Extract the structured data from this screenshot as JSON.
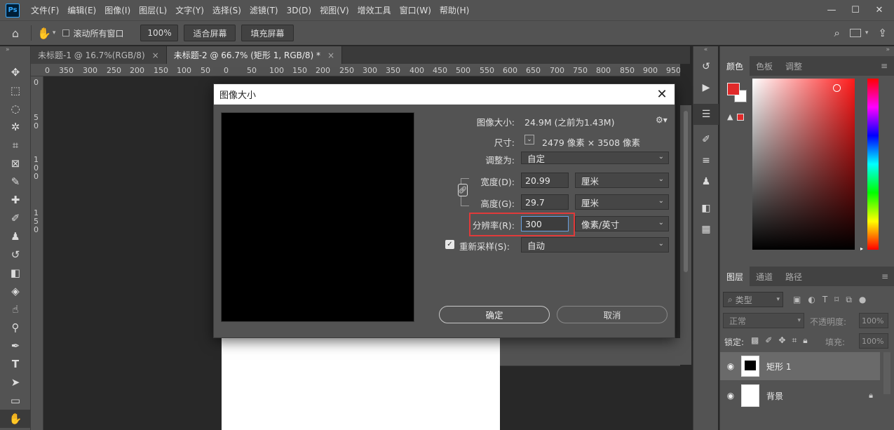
{
  "app": {
    "logo_text": "Ps"
  },
  "menu": [
    "文件(F)",
    "编辑(E)",
    "图像(I)",
    "图层(L)",
    "文字(Y)",
    "选择(S)",
    "滤镜(T)",
    "3D(D)",
    "视图(V)",
    "增效工具",
    "窗口(W)",
    "帮助(H)"
  ],
  "options": {
    "scroll_all_label": "滚动所有窗口",
    "zoom_value": "100%",
    "fit_screen": "适合屏幕",
    "fill_screen": "填充屏幕"
  },
  "tabs": [
    {
      "label": "未标题-1 @ 16.7%(RGB/8)",
      "active": false
    },
    {
      "label": "未标题-2 @ 66.7% (矩形 1, RGB/8) *",
      "active": true
    }
  ],
  "ruler_h": [
    "0",
    "350",
    "300",
    "250",
    "200",
    "150",
    "100",
    "50",
    "0",
    "50",
    "100",
    "150",
    "200",
    "250",
    "300",
    "350",
    "400",
    "450",
    "500",
    "550",
    "600",
    "650",
    "700",
    "750",
    "800",
    "850",
    "900",
    "950"
  ],
  "ruler_v": [
    "0",
    "5",
    "0",
    "1",
    "0",
    "0",
    "1",
    "5",
    "0"
  ],
  "dialog": {
    "title": "图像大小",
    "image_size_label": "图像大小:",
    "image_size_value": "24.9M (之前为1.43M)",
    "dimensions_label": "尺寸:",
    "dimensions_value": "2479 像素 × 3508 像素",
    "fit_to_label": "调整为:",
    "fit_to_value": "自定",
    "width_label": "宽度(D):",
    "width_value": "20.99",
    "width_unit": "厘米",
    "height_label": "高度(G):",
    "height_value": "29.7",
    "height_unit": "厘米",
    "resolution_label": "分辨率(R):",
    "resolution_value": "300",
    "resolution_unit": "像素/英寸",
    "resample_label": "重新采样(S):",
    "resample_value": "自动",
    "resample_checked": true,
    "ok_label": "确定",
    "cancel_label": "取消",
    "highlight_color": "#e03a3a"
  },
  "panels": {
    "color_tabs": [
      "颜色",
      "色板",
      "调整"
    ],
    "layers_tabs": [
      "图层",
      "通道",
      "路径"
    ],
    "layers_kind": "类型",
    "blend_mode": "正常",
    "opacity_label": "不透明度:",
    "opacity_value": "100%",
    "lock_label": "锁定:",
    "fill_label": "填充:",
    "fill_value": "100%",
    "layers": [
      {
        "name": "矩形 1",
        "selected": true
      },
      {
        "name": "背景",
        "selected": false,
        "locked": true
      }
    ],
    "foreground_color": "#e02a2a",
    "background_color": "#ffffff"
  }
}
